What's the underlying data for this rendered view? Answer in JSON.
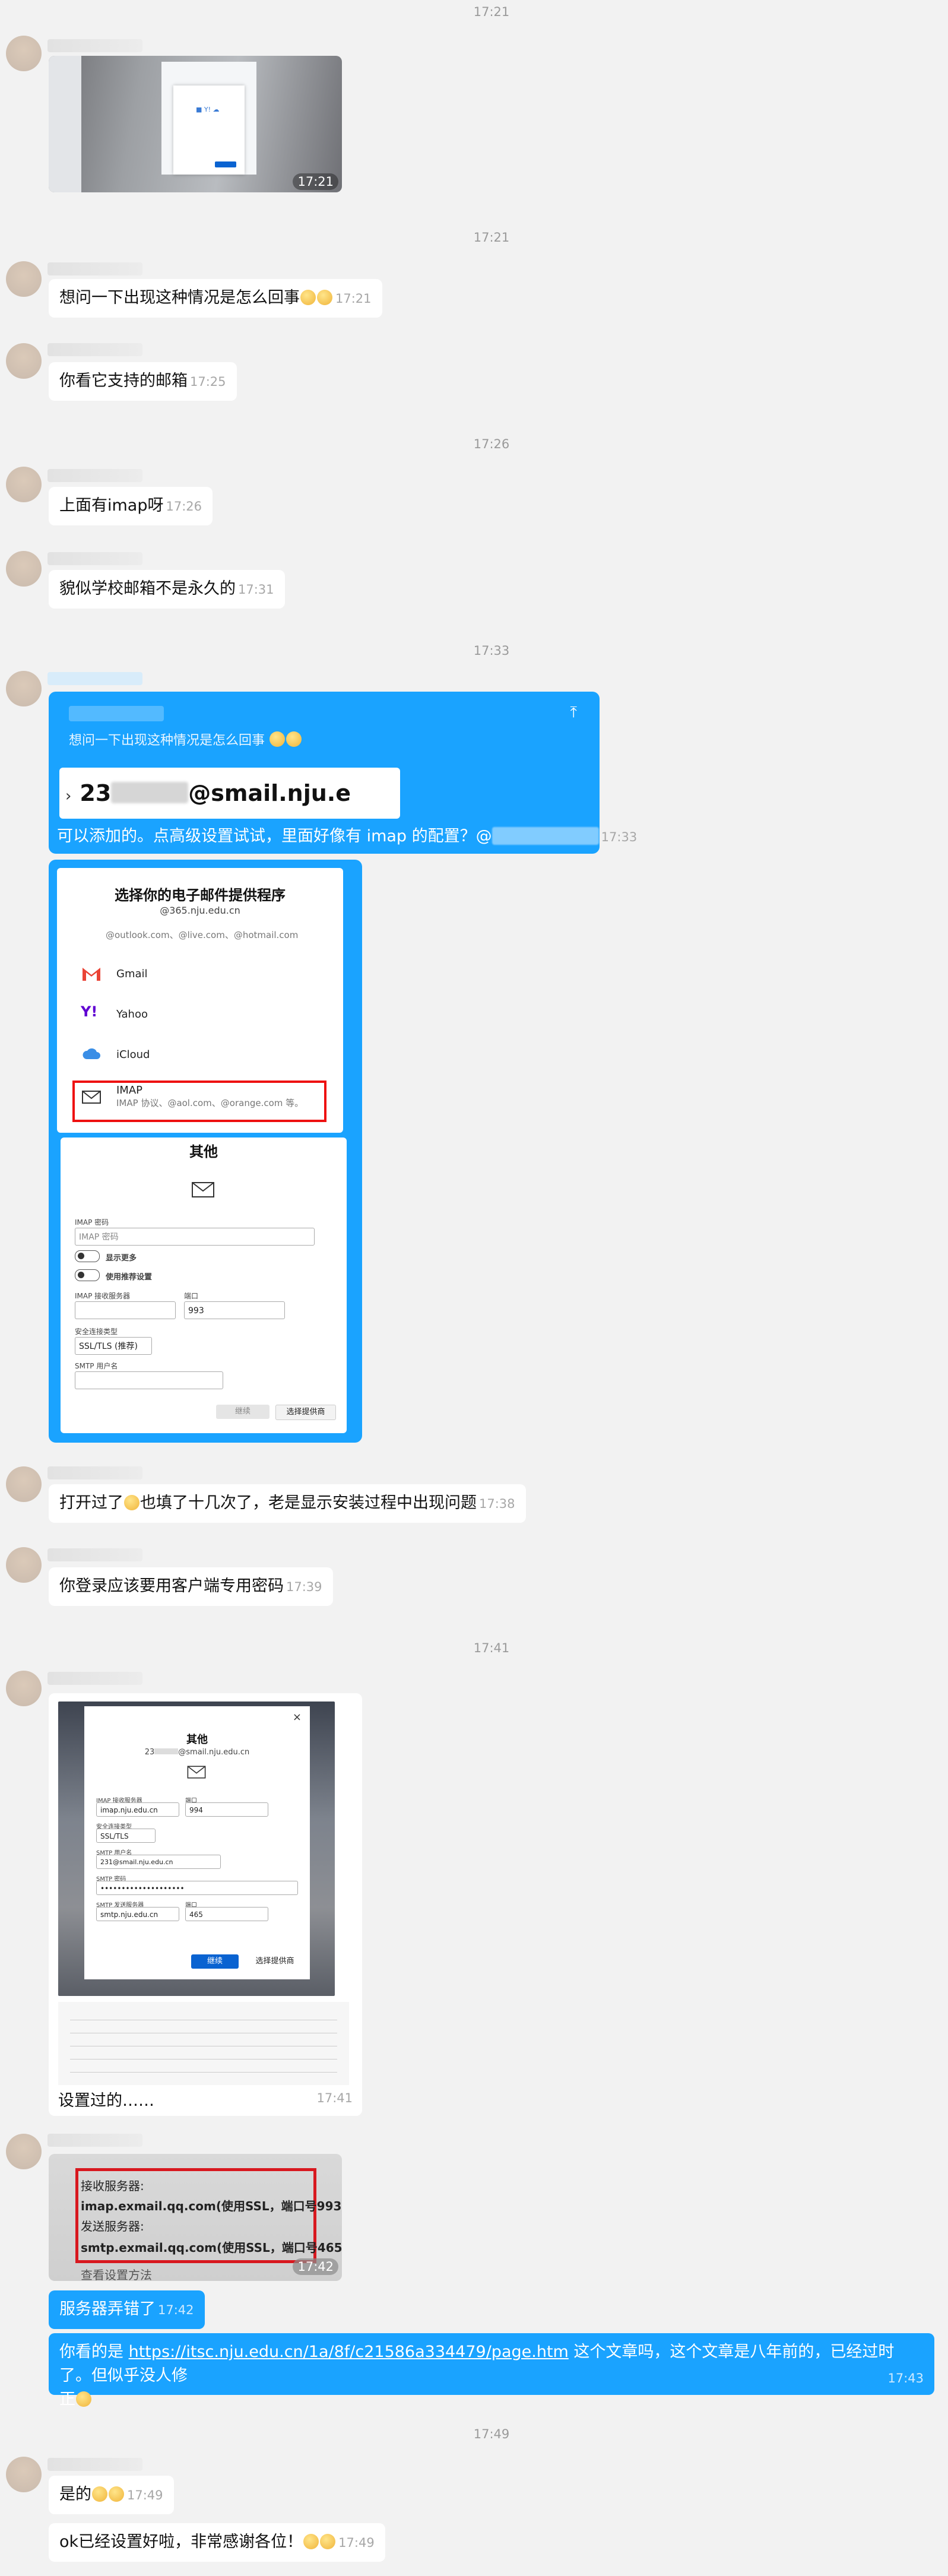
{
  "timestamps": {
    "t1": "17:21",
    "t2": "17:21",
    "t3": "17:26",
    "t4": "17:33",
    "t5": "17:41",
    "t6": "17:49"
  },
  "messages": {
    "m_img1_time": "17:21",
    "m2_text": "想问一下出现这种情况是怎么回事",
    "m2_time": "17:21",
    "m3_text": "你看它支持的邮箱",
    "m3_time": "17:25",
    "m4_text": "上面有imap呀",
    "m4_time": "17:26",
    "m5_text": "貌似学校邮箱不是永久的",
    "m5_time": "17:31",
    "quote_text": "想问一下出现这种情况是怎么回事",
    "quote_box_prefix": "23",
    "quote_box_suffix": "@smail.nju.e",
    "m6_text": "可以添加的。点高级设置试试，里面好像有 imap 的配置？@",
    "m6_time": "17:33",
    "m7_text": "打开过了",
    "m7_text2": "也填了十几次了，老是显示安装过程中出现问题",
    "m7_time": "17:38",
    "m8_text": "你登录应该要用客户端专用密码",
    "m8_time": "17:39",
    "m9_text": "设置过的……",
    "m9_time": "17:41",
    "img4_time": "17:42",
    "m10_text": "服务器弄错了",
    "m10_time": "17:42",
    "m11_prefix": "你看的是 ",
    "m11_link": "https://itsc.nju.edu.cn/1a/8f/c21586a334479/page.htm",
    "m11_suffix": " 这个文章吗，这个文章是八年前的，已经过时了。但似乎没人修",
    "m11_line2": "正",
    "m11_time": "17:43",
    "m12_text": "是的",
    "m12_time": "17:49",
    "m13_text": "ok已经设置好啦，非常感谢各位！",
    "m13_time": "17:49"
  },
  "provider_panel": {
    "title": "选择你的电子邮件提供程序",
    "account": "@365.nju.edu.cn",
    "outlook": "@outlook.com、@live.com、@hotmail.com",
    "gmail": "Gmail",
    "yahoo": "Yahoo",
    "icloud": "iCloud",
    "imap": "IMAP",
    "imap_sub": "IMAP 协议、@aol.com、@orange.com 等。"
  },
  "other_panel": {
    "title": "其他",
    "imap_password_label": "IMAP 密码",
    "imap_password_ph": "IMAP 密码",
    "show_more": "显示更多",
    "use_recommended": "使用推荐设置",
    "imap_server_label": "IMAP 接收服务器",
    "port_label": "端口",
    "port_value": "993",
    "security_label": "安全连接类型",
    "security_value": "SSL/TLS (推荐)",
    "smtp_user_label": "SMTP 用户名",
    "back_button": "继续",
    "choose_button": "选择提供商"
  },
  "settings_panel": {
    "title": "其他",
    "account_prefix": "23",
    "account_suffix": "@smail.nju.edu.cn",
    "imap_server_label": "IMAP 接收服务器",
    "imap_server_value": "imap.nju.edu.cn",
    "port_label": "端口",
    "port_value": "994",
    "security_label": "安全连接类型",
    "security_value": "SSL/TLS",
    "smtp_user_label": "SMTP 用户名",
    "smtp_user_value": "231@smail.nju.edu.cn",
    "smtp_password_label": "SMTP 密码",
    "smtp_password_value": "••••••••••••••••••••",
    "smtp_server_label": "SMTP 发送服务器",
    "smtp_server_value": "smtp.nju.edu.cn",
    "smtp_port_label": "端口",
    "smtp_port_value": "465",
    "continue_button": "继续",
    "choose_button": "选择提供商"
  },
  "server_info": {
    "incoming_label": "接收服务器:",
    "incoming_value": "imap.exmail.qq.com(使用SSL，端口号993)",
    "outgoing_label": "发送服务器:",
    "outgoing_value": "smtp.exmail.qq.com(使用SSL，端口号465)",
    "footer": "查看设置方法"
  },
  "colors": {
    "accent_blue": "#1aa3ff",
    "background": "#f2f2f2",
    "highlight_red": "#e11111"
  }
}
